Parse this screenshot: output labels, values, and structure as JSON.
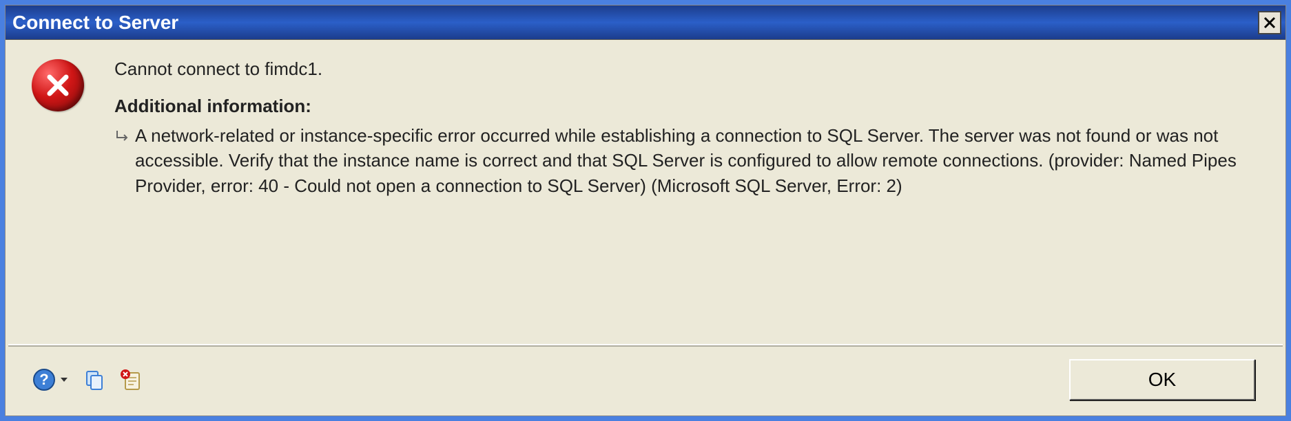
{
  "dialog": {
    "title": "Connect to Server",
    "main_message": "Cannot connect to fimdc1.",
    "additional_heading": "Additional information:",
    "detail": "A network-related or instance-specific error occurred while establishing a connection to SQL Server. The server was not found or was not accessible. Verify that the instance name is correct and that SQL Server is configured to allow remote connections. (provider: Named Pipes Provider, error: 40 - Could not open a connection to SQL Server) (Microsoft SQL Server, Error: 2)"
  },
  "footer": {
    "ok_label": "OK"
  }
}
